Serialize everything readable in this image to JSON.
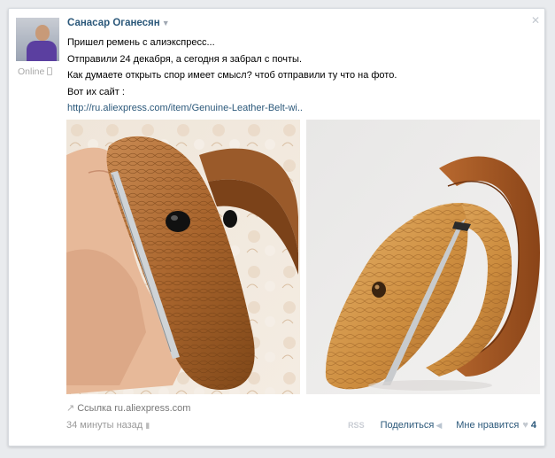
{
  "post": {
    "author": "Санасар Оганесян",
    "status": "Online",
    "text_lines": [
      "Пришел ремень с алиэкспресс...",
      "Отправили 24 декабря, а сегодня я забрал с почты.",
      "Как думаете открыть спор имеет смысл? чтоб отправили ту что на фото.",
      "Вот их сайт :"
    ],
    "link_url": "http://ru.aliexpress.com/item/Genuine-Leather-Belt-wi..",
    "link_source_label": "Ссылка",
    "link_source_domain": "ru.aliexpress.com",
    "time": "34 минуты назад",
    "share_label": "Поделиться",
    "like_label": "Мне нравится",
    "like_count": "4",
    "close_glyph": "✕",
    "icons": {
      "rss": "rss-icon",
      "share": "megaphone-icon",
      "like": "heart-icon",
      "link": "link-arrow-icon",
      "phone": "phone-icon",
      "dropdown": "caret-down-icon"
    }
  }
}
